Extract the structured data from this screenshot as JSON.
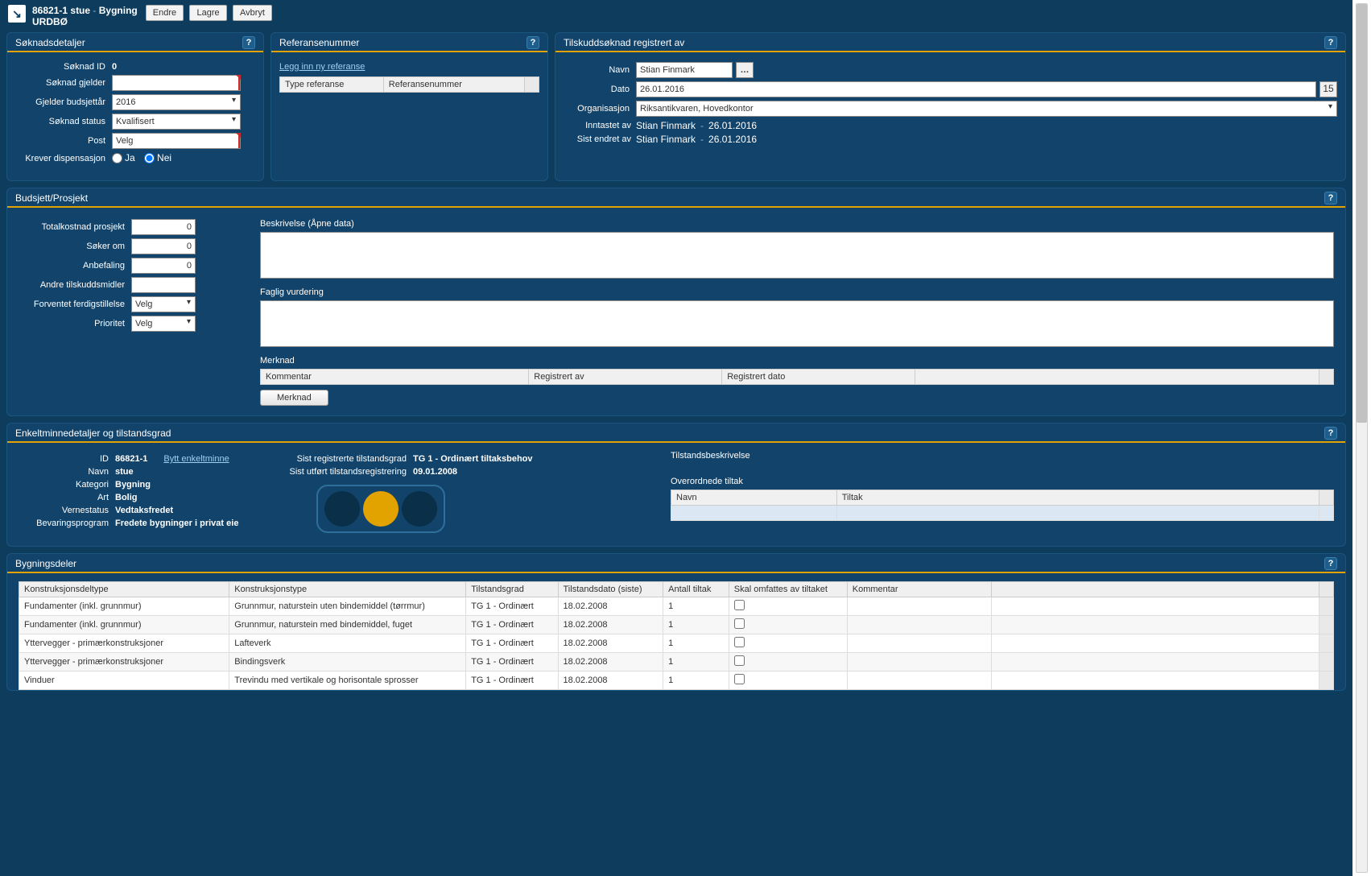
{
  "header": {
    "id": "86821-1",
    "name": "stue",
    "sep": "-",
    "cat": "Bygning",
    "sub": "URDBØ",
    "btn_edit": "Endre",
    "btn_save": "Lagre",
    "btn_cancel": "Avbryt"
  },
  "panel_app": {
    "title": "Søknadsdetaljer",
    "lbl_id": "Søknad ID",
    "val_id": "0",
    "lbl_gjelder": "Søknad gjelder",
    "lbl_budyear": "Gjelder budsjettår",
    "val_budyear": "2016",
    "lbl_status": "Søknad status",
    "val_status": "Kvalifisert",
    "lbl_post": "Post",
    "val_post": "Velg",
    "lbl_disp": "Krever dispensasjon",
    "opt_ja": "Ja",
    "opt_nei": "Nei"
  },
  "panel_ref": {
    "title": "Referansenummer",
    "link_add": "Legg inn ny referanse",
    "col1": "Type referanse",
    "col2": "Referansenummer"
  },
  "panel_reg": {
    "title": "Tilskuddsøknad registrert av",
    "lbl_navn": "Navn",
    "val_navn": "Stian Finmark",
    "lbl_dato": "Dato",
    "val_dato": "26.01.2016",
    "lbl_org": "Organisasjon",
    "val_org": "Riksantikvaren, Hovedkontor",
    "lbl_innt": "Inntastet av",
    "val_innt_n": "Stian Finmark",
    "val_innt_d": "26.01.2016",
    "lbl_sist": "Sist endret av",
    "val_sist_n": "Stian Finmark",
    "val_sist_d": "26.01.2016",
    "cal": "15"
  },
  "panel_bud": {
    "title": "Budsjett/Prosjekt",
    "lbl_tot": "Totalkostnad prosjekt",
    "val_tot": "0",
    "lbl_sok": "Søker om",
    "val_sok": "0",
    "lbl_anb": "Anbefaling",
    "val_anb": "0",
    "lbl_andre": "Andre tilskuddsmidler",
    "val_andre": "",
    "lbl_ferdig": "Forventet ferdigstillelse",
    "val_ferdig": "Velg",
    "lbl_prio": "Prioritet",
    "val_prio": "Velg",
    "lbl_beskr": "Beskrivelse (Åpne data)",
    "lbl_faglig": "Faglig vurdering",
    "lbl_merkn": "Merknad",
    "col_kom": "Kommentar",
    "col_reg": "Registrert av",
    "col_dato": "Registrert dato",
    "btn_merkn": "Merknad"
  },
  "panel_enk": {
    "title": "Enkeltminnedetaljer og tilstandsgrad",
    "lbl_id": "ID",
    "val_id": "86821-1",
    "link_bytt": "Bytt enkeltminne",
    "lbl_navn": "Navn",
    "val_navn": "stue",
    "lbl_kat": "Kategori",
    "val_kat": "Bygning",
    "lbl_art": "Art",
    "val_art": "Bolig",
    "lbl_vern": "Vernestatus",
    "val_vern": "Vedtaksfredet",
    "lbl_bev": "Bevaringsprogram",
    "val_bev": "Fredete bygninger i privat eie",
    "lbl_sreg": "Sist registrerte tilstandsgrad",
    "val_sreg": "TG 1 - Ordinært tiltaksbehov",
    "lbl_sutf": "Sist utført tilstandsregistrering",
    "val_sutf": "09.01.2008",
    "lbl_tilbeskr": "Tilstandsbeskrivelse",
    "lbl_over": "Overordnede tiltak",
    "over_col1": "Navn",
    "over_col2": "Tiltak"
  },
  "panel_byg": {
    "title": "Bygningsdeler",
    "cols": [
      "Konstruksjonsdeltype",
      "Konstruksjonstype",
      "Tilstandsgrad",
      "Tilstandsdato (siste)",
      "Antall tiltak",
      "Skal omfattes av tiltaket",
      "Kommentar"
    ],
    "rows": [
      [
        "Fundamenter (inkl. grunnmur)",
        "Grunnmur, naturstein uten bindemiddel (tørrmur)",
        "TG 1 - Ordinært",
        "18.02.2008",
        "1",
        "",
        ""
      ],
      [
        "Fundamenter (inkl. grunnmur)",
        "Grunnmur, naturstein med bindemiddel, fuget",
        "TG 1 - Ordinært",
        "18.02.2008",
        "1",
        "",
        ""
      ],
      [
        "Yttervegger - primærkonstruksjoner",
        "Lafteverk",
        "TG 1 - Ordinært",
        "18.02.2008",
        "1",
        "",
        ""
      ],
      [
        "Yttervegger - primærkonstruksjoner",
        "Bindingsverk",
        "TG 1 - Ordinært",
        "18.02.2008",
        "1",
        "",
        ""
      ],
      [
        "Vinduer",
        "Trevindu med vertikale og horisontale sprosser",
        "TG 1 - Ordinært",
        "18.02.2008",
        "1",
        "",
        ""
      ]
    ]
  }
}
